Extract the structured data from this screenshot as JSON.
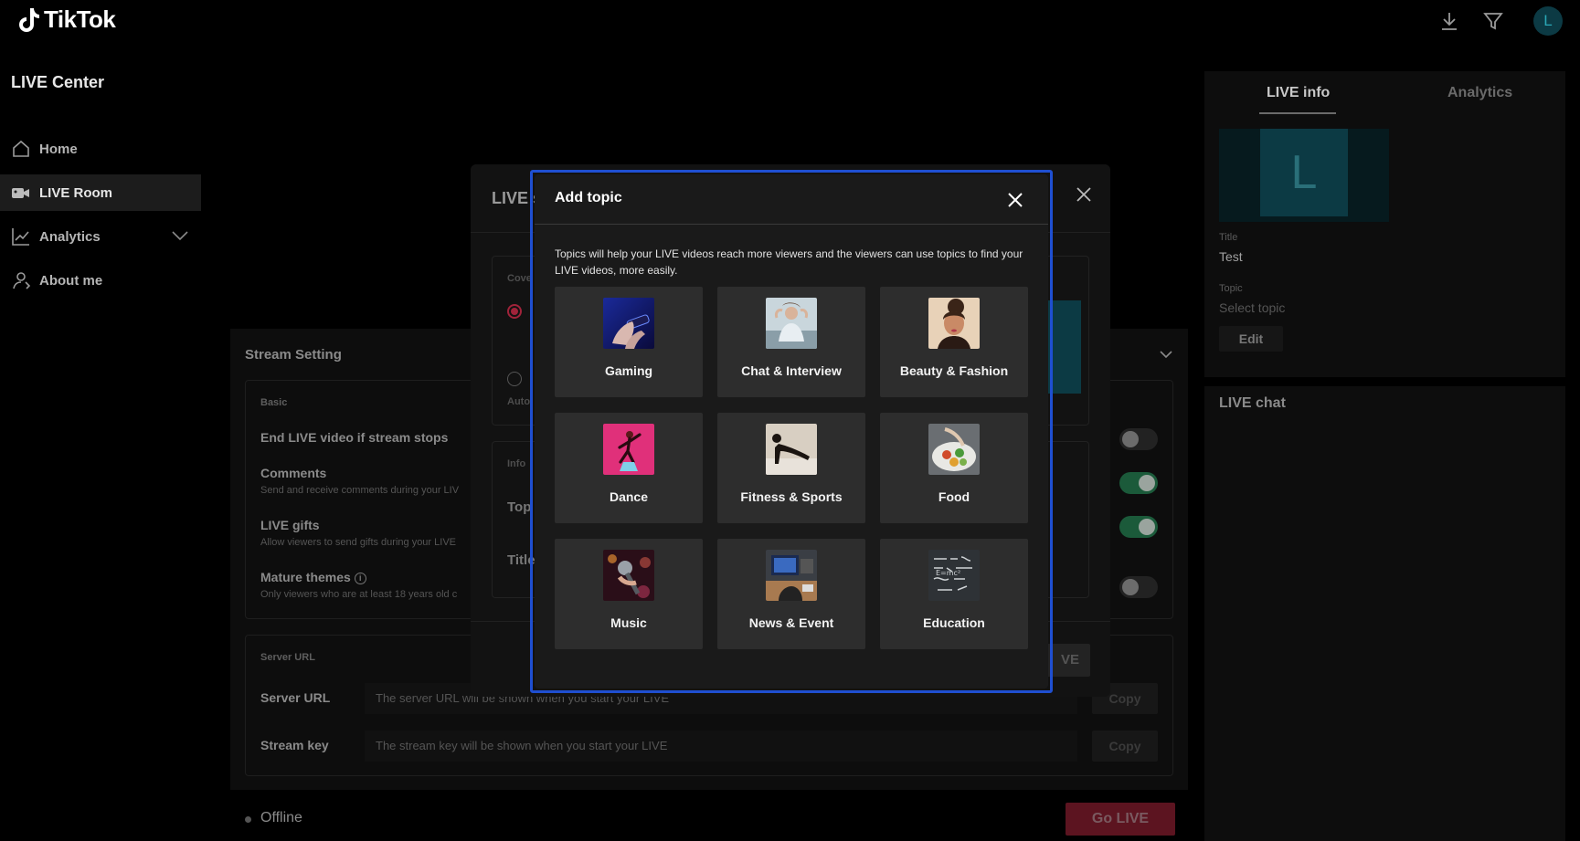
{
  "app": {
    "brand": "TikTok",
    "avatar_letter": "L"
  },
  "sidebar": {
    "title": "LIVE Center",
    "items": [
      {
        "label": "Home",
        "icon": "home-icon"
      },
      {
        "label": "LIVE Room",
        "icon": "video-camera-icon"
      },
      {
        "label": "Analytics",
        "icon": "chart-line-icon"
      },
      {
        "label": "About me",
        "icon": "person-icon"
      }
    ]
  },
  "stream_setting": {
    "title": "Stream Setting",
    "basic_label": "Basic",
    "settings": [
      {
        "title": "End LIVE video if stream stops",
        "desc": "",
        "on": false
      },
      {
        "title": "Comments",
        "desc": "Send and receive comments during your LIV",
        "on": true
      },
      {
        "title": "LIVE gifts",
        "desc": "Allow viewers to send gifts during your LIVE",
        "on": true
      },
      {
        "title": "Mature themes",
        "desc": "Only viewers who are at least 18 years old c",
        "on": false
      }
    ],
    "server_label": "Server URL",
    "server_url_label": "Server URL",
    "server_url_value": "The server URL will be shown when you start your LIVE",
    "stream_key_label": "Stream key",
    "stream_key_value": "The stream key will be shown when you start your LIVE",
    "copy_label": "Copy"
  },
  "status": {
    "text": "Offline",
    "go_live": "Go LIVE"
  },
  "right_panel": {
    "tab_info": "LIVE info",
    "tab_analytics": "Analytics",
    "cover_letter": "L",
    "title_label": "Title",
    "title_value": "Test",
    "topic_label": "Topic",
    "topic_value": "Select topic",
    "edit_label": "Edit",
    "chat_title": "LIVE chat"
  },
  "bg_dialog": {
    "title": "LIVE s",
    "cover_label": "Cove",
    "auto_label": "Auto",
    "info_label": "Info",
    "topic_field": "Top",
    "title_field": "Title",
    "live_btn": "VE"
  },
  "modal": {
    "title": "Add topic",
    "description": "Topics will help your LIVE videos reach more viewers and the viewers can use topics to find your LIVE videos, more easily.",
    "topics": [
      {
        "label": "Gaming",
        "icon": "gaming-thumbnail"
      },
      {
        "label": "Chat & Interview",
        "icon": "chat-thumbnail"
      },
      {
        "label": "Beauty & Fashion",
        "icon": "beauty-thumbnail"
      },
      {
        "label": "Dance",
        "icon": "dance-thumbnail"
      },
      {
        "label": "Fitness & Sports",
        "icon": "fitness-thumbnail"
      },
      {
        "label": "Food",
        "icon": "food-thumbnail"
      },
      {
        "label": "Music",
        "icon": "music-thumbnail"
      },
      {
        "label": "News & Event",
        "icon": "news-thumbnail"
      },
      {
        "label": "Education",
        "icon": "education-thumbnail"
      }
    ]
  },
  "colors": {
    "accent_red": "#fe2c55",
    "modal_outline": "#1f4fd1",
    "teal_avatar": "#0c3a44"
  }
}
